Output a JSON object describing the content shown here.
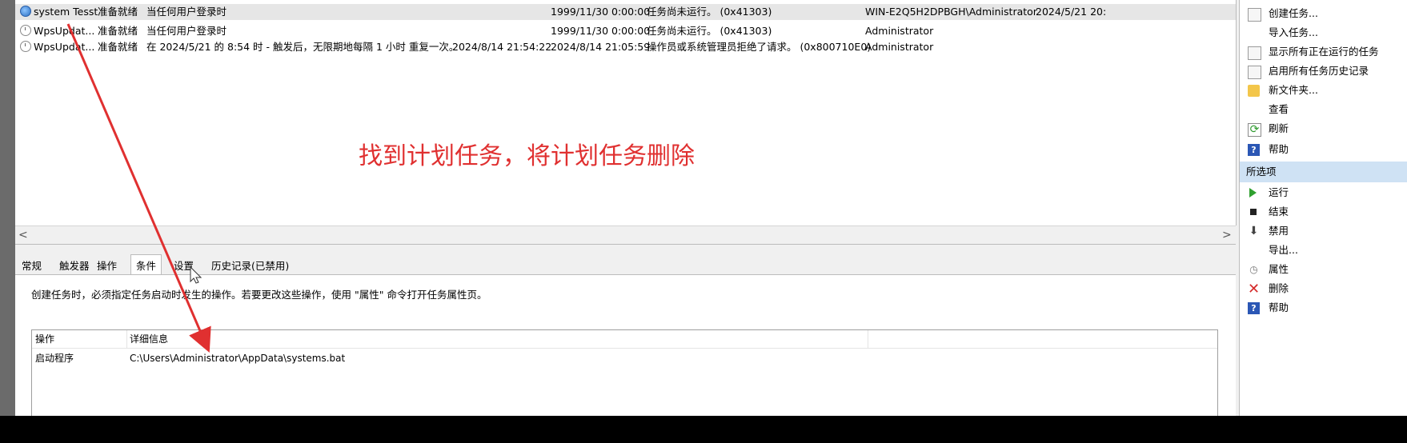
{
  "task_list": {
    "rows": [
      {
        "name": "system Tesst",
        "status": "准备就绪",
        "trigger": "当任何用户登录时",
        "next_run": "",
        "last_run": "1999/11/30 0:00:00",
        "result": "任务尚未运行。 (0x41303)",
        "author": "WIN-E2Q5H2DPBGH\\Administrator",
        "created": "2024/5/21 20:",
        "icon": "clock-blue-icon",
        "selected": true
      },
      {
        "name": "WpsUpdat...",
        "status": "准备就绪",
        "trigger": "当任何用户登录时",
        "next_run": "",
        "last_run": "1999/11/30 0:00:00",
        "result": "任务尚未运行。 (0x41303)",
        "author": "Administrator",
        "created": "",
        "icon": "clock-gray-icon",
        "selected": false
      },
      {
        "name": "WpsUpdat...",
        "status": "准备就绪",
        "trigger": "在 2024/5/21 的 8:54 时 - 触发后，无限期地每隔 1 小时 重复一次。",
        "next_run": "2024/8/14 21:54:22",
        "last_run": "2024/8/14 21:05:59",
        "result": "操作员或系统管理员拒绝了请求。 (0x800710E0)",
        "author": "Administrator",
        "created": "",
        "icon": "clock-gray-icon",
        "selected": false
      }
    ]
  },
  "scrollbar": {
    "left": "<",
    "right": ">"
  },
  "tabs": [
    "常规",
    "触发器",
    "操作",
    "条件",
    "设置",
    "历史记录(已禁用)"
  ],
  "active_tab": "条件",
  "panel": {
    "description": "创建任务时，必须指定任务启动时发生的操作。若要更改这些操作，使用 \"属性\" 命令打开任务属性页。",
    "table": {
      "headers": [
        "操作",
        "详细信息"
      ],
      "rows": [
        {
          "action": "启动程序",
          "details": "C:\\Users\\Administrator\\AppData\\systems.bat"
        }
      ]
    }
  },
  "right_pane": {
    "top_items": [
      {
        "label": "创建任务...",
        "icon": "create-task-icon"
      },
      {
        "label": "导入任务...",
        "icon": ""
      },
      {
        "label": "显示所有正在运行的任务",
        "icon": "running-tasks-icon"
      },
      {
        "label": "启用所有任务历史记录",
        "icon": "history-icon"
      },
      {
        "label": "新文件夹...",
        "icon": "folder-icon"
      },
      {
        "label": "查看",
        "icon": ""
      },
      {
        "label": "刷新",
        "icon": "refresh-icon"
      },
      {
        "label": "帮助",
        "icon": "help-icon"
      }
    ],
    "section_title": "所选项",
    "selected_items": [
      {
        "label": "运行",
        "icon": "play-icon"
      },
      {
        "label": "结束",
        "icon": "stop-icon"
      },
      {
        "label": "禁用",
        "icon": "disable-arrow-icon"
      },
      {
        "label": "导出...",
        "icon": ""
      },
      {
        "label": "属性",
        "icon": "properties-icon"
      },
      {
        "label": "删除",
        "icon": "delete-x-icon"
      },
      {
        "label": "帮助",
        "icon": "help-icon"
      }
    ]
  },
  "annotation": {
    "text": "找到计划任务，将计划任务删除",
    "color": "#e03030"
  },
  "colors": {
    "section_bg": "#cfe2f4",
    "accent": "#2b57b5"
  }
}
